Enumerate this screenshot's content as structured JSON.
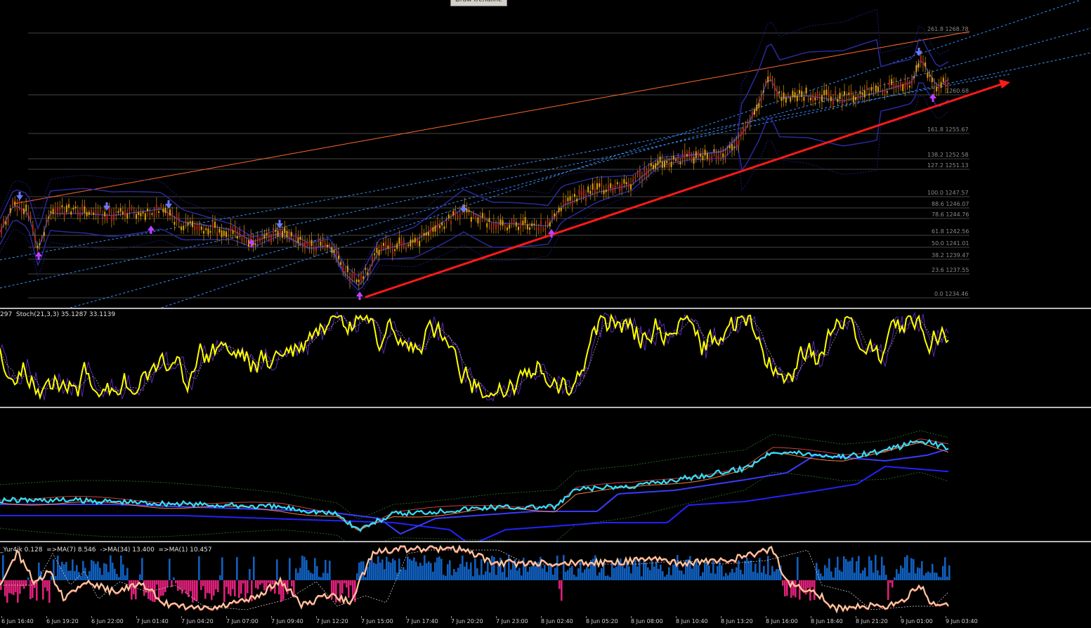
{
  "tooltip": "Draw trendline",
  "fib_levels": [
    {
      "label": "261.8 1268.78"
    },
    {
      "label": "1260.68"
    },
    {
      "label": "161.8 1255.67"
    },
    {
      "label": "138.2 1252.58"
    },
    {
      "label": "127.2 1251.13"
    },
    {
      "label": "100.0 1247.57"
    },
    {
      "label": "88.6 1246.07"
    },
    {
      "label": "78.6 1244.76"
    },
    {
      "label": "61.8 1242.56"
    },
    {
      "label": "50.0 1241.01"
    },
    {
      "label": "38.2 1239.47"
    },
    {
      "label": "23.6 1237.55"
    },
    {
      "label": "0.0 1234.46"
    }
  ],
  "stoch_title": "297  Stoch(21,3,3) 35.1287 33.1139",
  "yur4ik_title": "_Yur4ik 0.128  =>MA(7) 8.546  ->MA(34) 13.400  =>MA(1) 10.457",
  "time_labels": [
    "6 Jun 16:40",
    "6 Jun 19:20",
    "6 Jun 22:00",
    "7 Jun 01:40",
    "7 Jun 04:20",
    "7 Jun 07:00",
    "7 Jun 09:40",
    "7 Jun 12:20",
    "7 Jun 15:00",
    "7 Jun 17:40",
    "7 Jun 20:20",
    "7 Jun 23:00",
    "8 Jun 02:40",
    "8 Jun 05:20",
    "8 Jun 08:00",
    "8 Jun 10:40",
    "8 Jun 13:20",
    "8 Jun 16:00",
    "8 Jun 18:40",
    "8 Jun 21:20",
    "9 Jun 01:00",
    "9 Jun 03:40"
  ],
  "colors": {
    "background": "#000000",
    "candle": "#e0a000",
    "trendline": "#ff1a1a",
    "channel_top": "#ff6a2a",
    "channel_dotted": "#3a8fff",
    "bollinger": "#2a2a9a",
    "stoch_main": "#ffff00",
    "stoch_signal": "#5a2ab8",
    "ma_cyan": "#33e0ff",
    "ma_blue": "#2222ff",
    "hist_pos": "#1060c0",
    "hist_neg": "#e0207a",
    "yur_line": "#ffc8a0"
  },
  "icons": [
    "arrow-up-icon",
    "arrow-down-icon"
  ]
}
